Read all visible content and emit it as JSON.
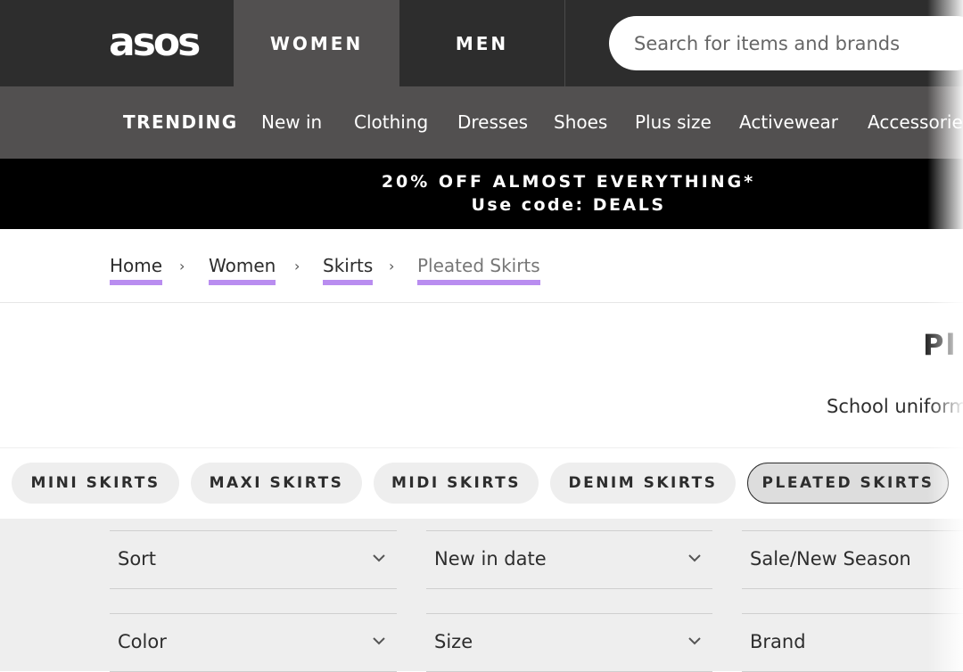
{
  "header": {
    "logo": "asos",
    "gender_tabs": [
      "WOMEN",
      "MEN"
    ],
    "search_placeholder": "Search for items and brands"
  },
  "category_nav": [
    "TRENDING",
    "New in",
    "Clothing",
    "Dresses",
    "Shoes",
    "Plus size",
    "Activewear",
    "Accessories"
  ],
  "promo": {
    "line1": "20% OFF ALMOST EVERYTHING*",
    "line2": "Use code: DEALS"
  },
  "breadcrumb": {
    "items": [
      "Home",
      "Women",
      "Skirts",
      "Pleated Skirts"
    ],
    "separator": "›",
    "underline_color": "#b98df0"
  },
  "page": {
    "title": "Pl",
    "subtitle": "School uniform"
  },
  "chips": [
    "MINI SKIRTS",
    "MAXI SKIRTS",
    "MIDI SKIRTS",
    "DENIM SKIRTS",
    "PLEATED SKIRTS"
  ],
  "active_chip": "PLEATED SKIRTS",
  "filters": [
    "Sort",
    "New in date",
    "Sale/New Season",
    "Color",
    "Size",
    "Brand"
  ],
  "colors": {
    "topbar": "#2d2d2d",
    "nav": "#525050",
    "promo": "#000000",
    "filters_bg": "#eeeeee"
  }
}
